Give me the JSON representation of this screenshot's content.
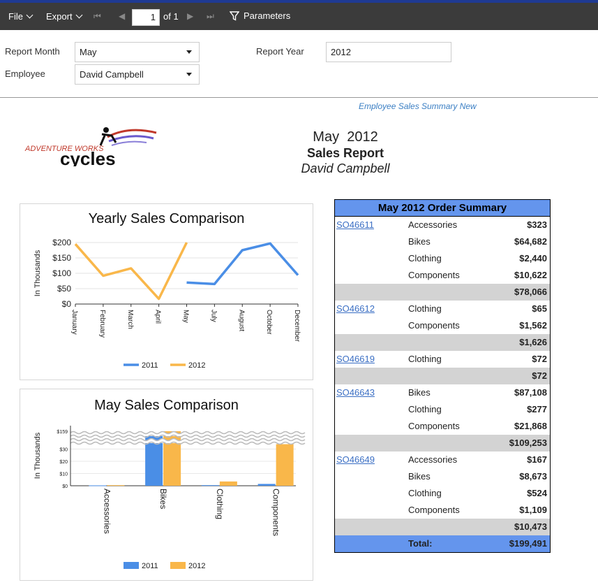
{
  "toolbar": {
    "file_label": "File",
    "export_label": "Export",
    "page_current": "1",
    "page_of": "of 1",
    "parameters_label": "Parameters"
  },
  "params": {
    "report_month_label": "Report Month",
    "report_month_value": "May",
    "employee_label": "Employee",
    "employee_value": "David Campbell",
    "report_year_label": "Report Year",
    "report_year_value": "2012"
  },
  "report": {
    "name": "Employee Sales Summary New",
    "logo_text_top": "ADVENTURE WORKS",
    "logo_text_bottom": "cycles",
    "month_year": "May  2012",
    "title": "Sales Report",
    "employee": "David Campbell"
  },
  "chart_data": [
    {
      "type": "line",
      "title": "Yearly Sales Comparison",
      "ylabel": "In Thousands",
      "categories": [
        "January",
        "February",
        "March",
        "April",
        "May",
        "July",
        "August",
        "October",
        "December"
      ],
      "ytick_labels": [
        "$0",
        "$50",
        "$100",
        "$150",
        "$200"
      ],
      "ylim": [
        0,
        200
      ],
      "series": [
        {
          "name": "2011",
          "color": "#4a8ee6",
          "values": [
            null,
            null,
            null,
            null,
            70,
            65,
            175,
            197,
            94
          ]
        },
        {
          "name": "2012",
          "color": "#f9b74a",
          "values": [
            195,
            92,
            116,
            17,
            200,
            null,
            null,
            null,
            null
          ]
        }
      ],
      "legend": "bottom"
    },
    {
      "type": "bar",
      "title": "May Sales Comparison",
      "ylabel": "In Thousands",
      "categories": [
        "Accessories",
        "Bikes",
        "Clothing",
        "Components"
      ],
      "ytick_labels": [
        "$0",
        "$10",
        "$20",
        "$30",
        "$159"
      ],
      "axis_break": true,
      "series": [
        {
          "name": "2011",
          "color": "#4a8ee6",
          "values": [
            0.3,
            152,
            0.5,
            1.5
          ]
        },
        {
          "name": "2012",
          "color": "#f9b74a",
          "values": [
            0.5,
            159,
            3.5,
            34
          ]
        }
      ],
      "legend": "bottom"
    }
  ],
  "order_summary": {
    "title": "May 2012 Order Summary",
    "rows": [
      {
        "order": "SO46611",
        "cat": "Accessories",
        "amt": "$323",
        "sub": false
      },
      {
        "order": "",
        "cat": "Bikes",
        "amt": "$64,682",
        "sub": false
      },
      {
        "order": "",
        "cat": "Clothing",
        "amt": "$2,440",
        "sub": false
      },
      {
        "order": "",
        "cat": "Components",
        "amt": "$10,622",
        "sub": false
      },
      {
        "order": "",
        "cat": "",
        "amt": "$78,066",
        "sub": true
      },
      {
        "order": "SO46612",
        "cat": "Clothing",
        "amt": "$65",
        "sub": false
      },
      {
        "order": "",
        "cat": "Components",
        "amt": "$1,562",
        "sub": false
      },
      {
        "order": "",
        "cat": "",
        "amt": "$1,626",
        "sub": true
      },
      {
        "order": "SO46619",
        "cat": "Clothing",
        "amt": "$72",
        "sub": false
      },
      {
        "order": "",
        "cat": "",
        "amt": "$72",
        "sub": true
      },
      {
        "order": "SO46643",
        "cat": "Bikes",
        "amt": "$87,108",
        "sub": false
      },
      {
        "order": "",
        "cat": "Clothing",
        "amt": "$277",
        "sub": false
      },
      {
        "order": "",
        "cat": "Components",
        "amt": "$21,868",
        "sub": false
      },
      {
        "order": "",
        "cat": "",
        "amt": "$109,253",
        "sub": true
      },
      {
        "order": "SO46649",
        "cat": "Accessories",
        "amt": "$167",
        "sub": false
      },
      {
        "order": "",
        "cat": "Bikes",
        "amt": "$8,673",
        "sub": false
      },
      {
        "order": "",
        "cat": "Clothing",
        "amt": "$524",
        "sub": false
      },
      {
        "order": "",
        "cat": "Components",
        "amt": "$1,109",
        "sub": false
      },
      {
        "order": "",
        "cat": "",
        "amt": "$10,473",
        "sub": true
      }
    ],
    "total_label": "Total:",
    "total_amt": "$199,491"
  }
}
